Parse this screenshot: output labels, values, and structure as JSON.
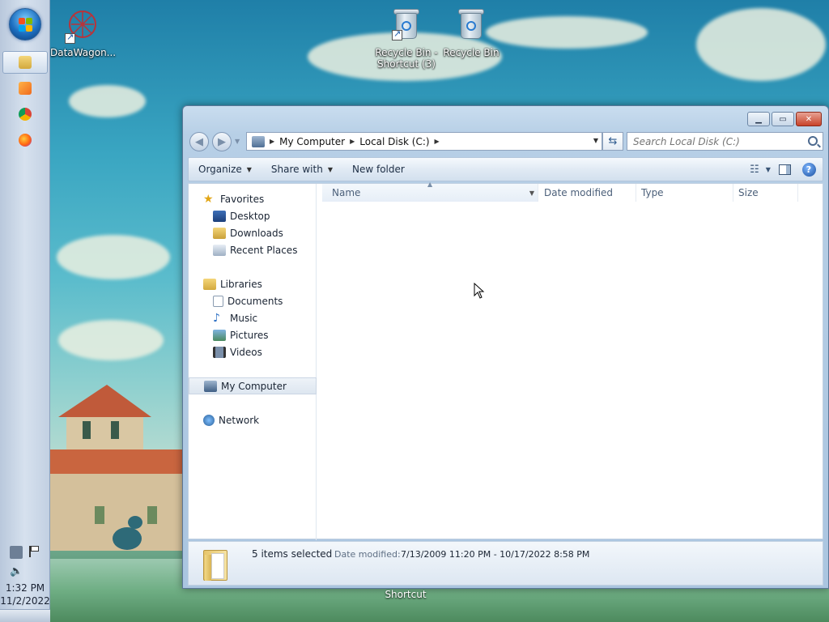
{
  "desktop": {
    "icons": [
      {
        "label": "DataWagon..."
      },
      {
        "label": "Recycle Bin - Shortcut (3)"
      },
      {
        "label": "Recycle Bin"
      }
    ],
    "bottom_label": "Shortcut"
  },
  "taskbar": {
    "time": "1:32 PM",
    "date": "11/2/2022"
  },
  "window": {
    "breadcrumbs": [
      "My Computer",
      "Local Disk (C:)"
    ],
    "search_placeholder": "Search Local Disk (C:)",
    "toolbar": {
      "organize": "Organize",
      "share_with": "Share with",
      "new_folder": "New folder"
    },
    "nav": {
      "favorites": "Favorites",
      "desktop": "Desktop",
      "downloads": "Downloads",
      "recent_places": "Recent Places",
      "libraries": "Libraries",
      "documents": "Documents",
      "music": "Music",
      "pictures": "Pictures",
      "videos": "Videos",
      "my_computer": "My Computer",
      "network": "Network"
    },
    "columns": {
      "name": "Name",
      "date_modified": "Date modified",
      "type": "Type",
      "size": "Size"
    },
    "details": {
      "count": "5 items selected",
      "date_label": "Date modified:",
      "date_value": "7/13/2009 11:20 PM - 10/17/2022 8:58 PM"
    }
  },
  "colors": {
    "accent": "#1d6fc0",
    "selection": "#dde6f0"
  }
}
